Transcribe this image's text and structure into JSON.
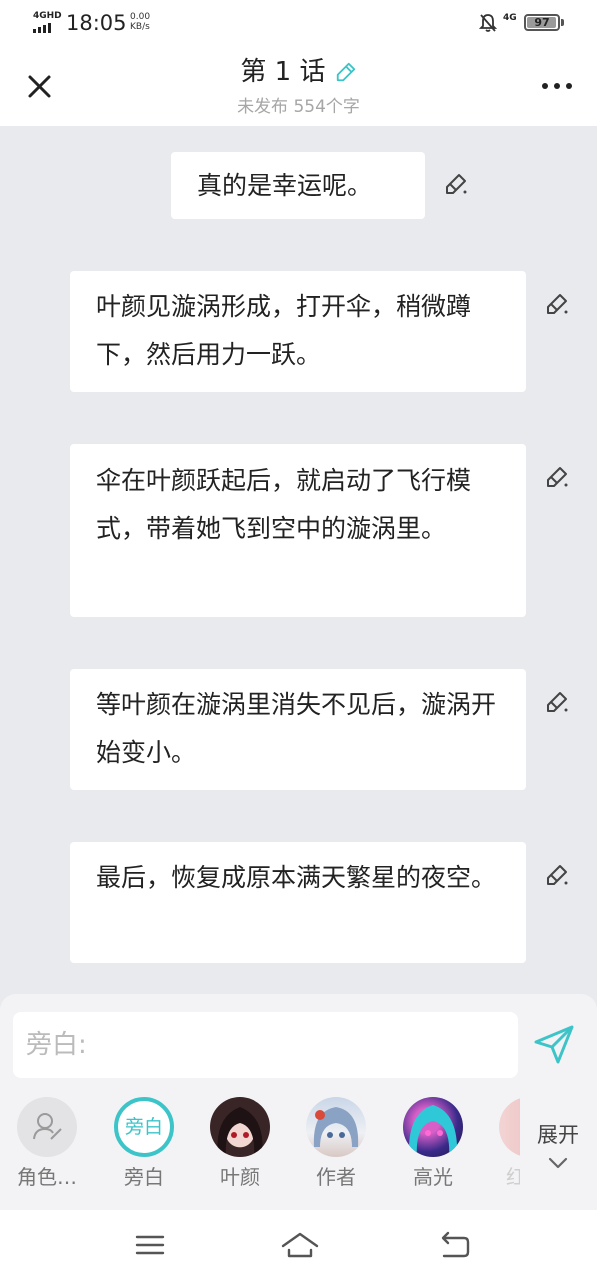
{
  "status_bar": {
    "signal": "4GHD",
    "time": "18:05",
    "speed_value": "0.00",
    "speed_unit": "KB/s",
    "network": "4G",
    "battery": "97",
    "battery_level": 0.97
  },
  "header": {
    "title": "第 1 话",
    "subtitle": "未发布 554个字"
  },
  "messages": [
    "真的是幸运呢。",
    "叶颜见漩涡形成，打开伞，稍微蹲下，然后用力一跃。",
    "伞在叶颜跃起后，就启动了飞行模式，带着她飞到空中的漩涡里。",
    "等叶颜在漩涡里消失不见后，漩涡开始变小。",
    "最后，恢复成原本满天繁星的夜空。"
  ],
  "input": {
    "placeholder": "旁白:"
  },
  "characters": [
    {
      "label": "角色…",
      "icon": "add-character-icon"
    },
    {
      "label": "旁白",
      "avatar_text": "旁白"
    },
    {
      "label": "叶颜"
    },
    {
      "label": "作者"
    },
    {
      "label": "高光"
    },
    {
      "label": "红"
    }
  ],
  "expand_label": "展开",
  "colors": {
    "accent": "#3cc4c8",
    "background": "#e9eaed",
    "bubble": "#ffffff"
  }
}
